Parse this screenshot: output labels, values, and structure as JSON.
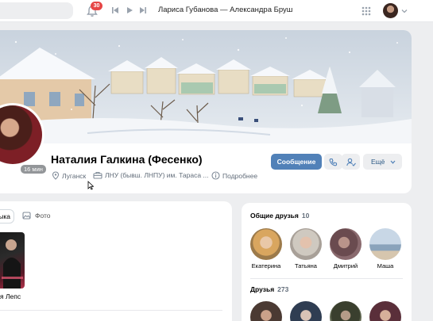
{
  "topbar": {
    "notifications_count": "30",
    "now_playing": "Лариса Губанова — Александра Бруш"
  },
  "profile": {
    "name": "Наталия Галкина (Фесенко)",
    "online_status": "16 мин",
    "city": "Луганск",
    "university": "ЛНУ (бывш. ЛНПУ) им. Тараса ...",
    "details_link": "Подробнее",
    "message_button": "Сообщение",
    "more_button": "Ещё"
  },
  "content": {
    "tab_partial": "ыка",
    "tab_photo": "Фото",
    "music_label": "я Лепс"
  },
  "friends": {
    "common_title": "Общие друзья",
    "common_count": "10",
    "common": [
      {
        "name": "Екатерина"
      },
      {
        "name": "Татьяна"
      },
      {
        "name": "Дмитрий"
      },
      {
        "name": "Маша"
      }
    ],
    "all_title": "Друзья",
    "all_count": "273"
  },
  "colors": {
    "accent": "#5181b8",
    "background": "#edeef0",
    "badge": "#e64646"
  }
}
